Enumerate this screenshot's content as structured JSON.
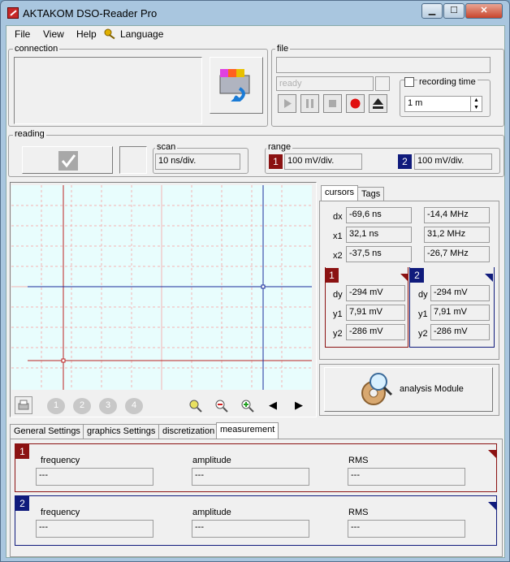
{
  "window": {
    "title": "AKTAKOM DSO-Reader Pro",
    "min": "▁",
    "max": "☐",
    "close": "✕"
  },
  "menu": {
    "file": "File",
    "view": "View",
    "help": "Help",
    "language": "Language"
  },
  "connection": {
    "label": "connection"
  },
  "file": {
    "label": "file",
    "status": "ready",
    "recording_label": "recording time",
    "recording_value": "1 m"
  },
  "reading": {
    "label": "reading"
  },
  "scan": {
    "label": "scan",
    "value": "10 ns/div."
  },
  "range": {
    "label": "range",
    "ch1_num": "1",
    "ch1_value": "100 mV/div.",
    "ch2_num": "2",
    "ch2_value": "100 mV/div."
  },
  "cursor_tabs": {
    "cursors": "cursors",
    "tags": "Tags"
  },
  "cursors": {
    "dx_label": "dx",
    "dx_t": "-69,6 ns",
    "dx_f": "-14,4 MHz",
    "x1_label": "x1",
    "x1_t": "32,1 ns",
    "x1_f": "31,2 MHz",
    "x2_label": "x2",
    "x2_t": "-37,5 ns",
    "x2_f": "-26,7 MHz",
    "ch1": {
      "num": "1",
      "dy_label": "dy",
      "dy": "-294 mV",
      "y1_label": "y1",
      "y1": "7,91 mV",
      "y2_label": "y2",
      "y2": "-286 mV"
    },
    "ch2": {
      "num": "2",
      "dy_label": "dy",
      "dy": "-294 mV",
      "y1_label": "y1",
      "y1": "7,91 mV",
      "y2_label": "y2",
      "y2": "-286 mV"
    }
  },
  "analysis": {
    "label": "analysis Module"
  },
  "toolbar": {
    "ch1": "1",
    "ch2": "2",
    "ch3": "3",
    "ch4": "4",
    "prev": "◀",
    "next": "▶"
  },
  "bottom_tabs": {
    "general": "General Settings",
    "graphics": "graphics Settings",
    "discretization": "discretization",
    "measurement": "measurement"
  },
  "measurement": {
    "ch1": {
      "num": "1",
      "freq_label": "frequency",
      "freq": "---",
      "amp_label": "amplitude",
      "amp": "---",
      "rms_label": "RMS",
      "rms": "---"
    },
    "ch2": {
      "num": "2",
      "freq_label": "frequency",
      "freq": "---",
      "amp_label": "amplitude",
      "amp": "---",
      "rms_label": "RMS",
      "rms": "---"
    }
  },
  "colors": {
    "ch1": "#8b1212",
    "ch2": "#101b7c",
    "plot_bg": "#e8fdfd",
    "titlebar": "#a9c6df"
  }
}
